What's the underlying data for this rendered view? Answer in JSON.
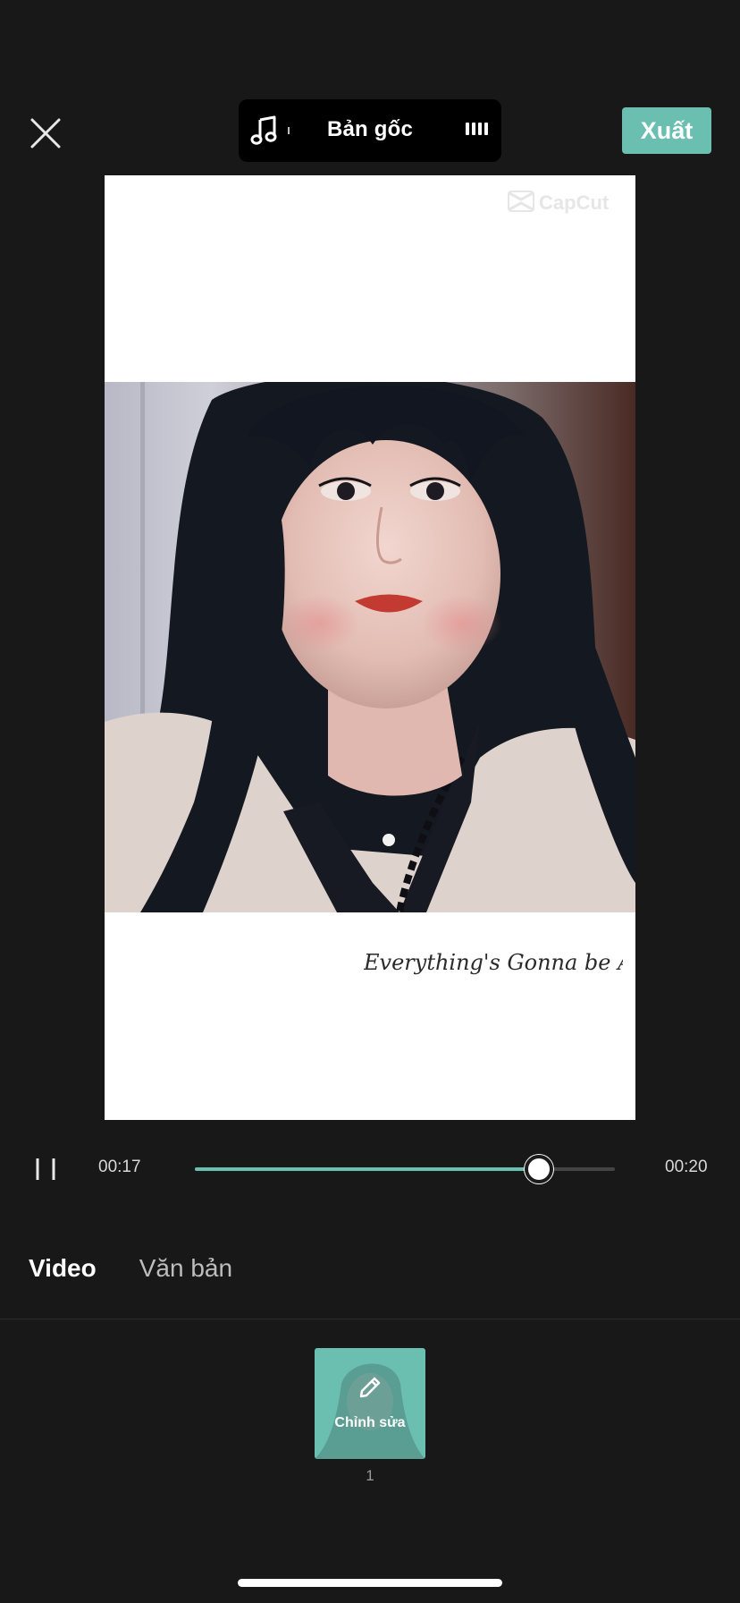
{
  "header": {
    "audio_label": "Bản gốc",
    "export_label": "Xuất",
    "icons": {
      "close": "close-icon",
      "music": "music-note-icon",
      "waveform": "waveform-icon"
    }
  },
  "preview": {
    "watermark_text": "CapCut",
    "caption": "Everything's Gonna be Alright."
  },
  "playback": {
    "current_time": "00:17",
    "total_time": "00:20",
    "progress": 0.82,
    "state": "paused"
  },
  "tabs": [
    {
      "label": "Video",
      "active": true
    },
    {
      "label": "Văn bản",
      "active": false
    }
  ],
  "clip": {
    "label": "Chỉnh sửa",
    "index": "1",
    "icon": "pencil-icon"
  },
  "colors": {
    "accent": "#6abfb0",
    "background": "#181818",
    "pill": "#000000"
  }
}
